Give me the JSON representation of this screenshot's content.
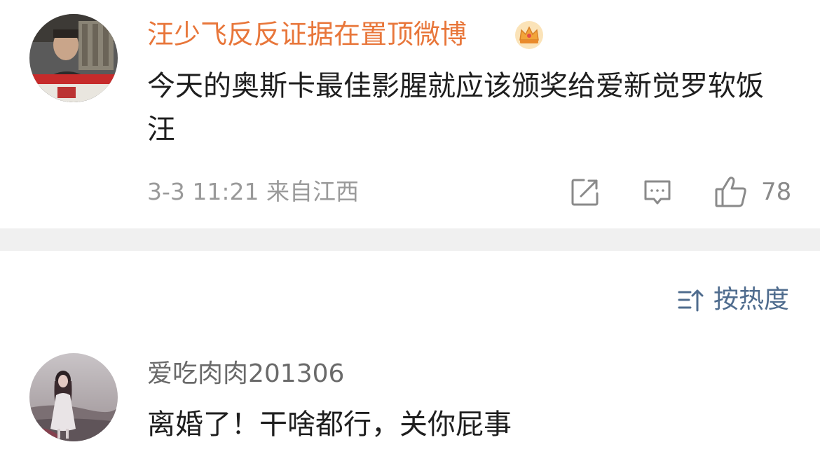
{
  "post": {
    "author": "汪少飞反反证据在置顶微博",
    "author_color": "#e8763a",
    "badge_icon": "crown-icon",
    "text": "今天的奥斯卡最佳影腥就应该颁奖给爱新觉罗软饭汪",
    "time": "3-3 11:21",
    "location": "来自江西",
    "actions": {
      "share_icon": "share-icon",
      "comment_icon": "comment-icon",
      "like_icon": "thumbs-up-icon",
      "like_count": "78"
    }
  },
  "sort": {
    "icon": "sort-icon",
    "label": "按热度",
    "color": "#4f6c8e"
  },
  "comments": [
    {
      "author": "爱吃肉肉201306",
      "text": "离婚了！干啥都行，关你屁事"
    }
  ]
}
